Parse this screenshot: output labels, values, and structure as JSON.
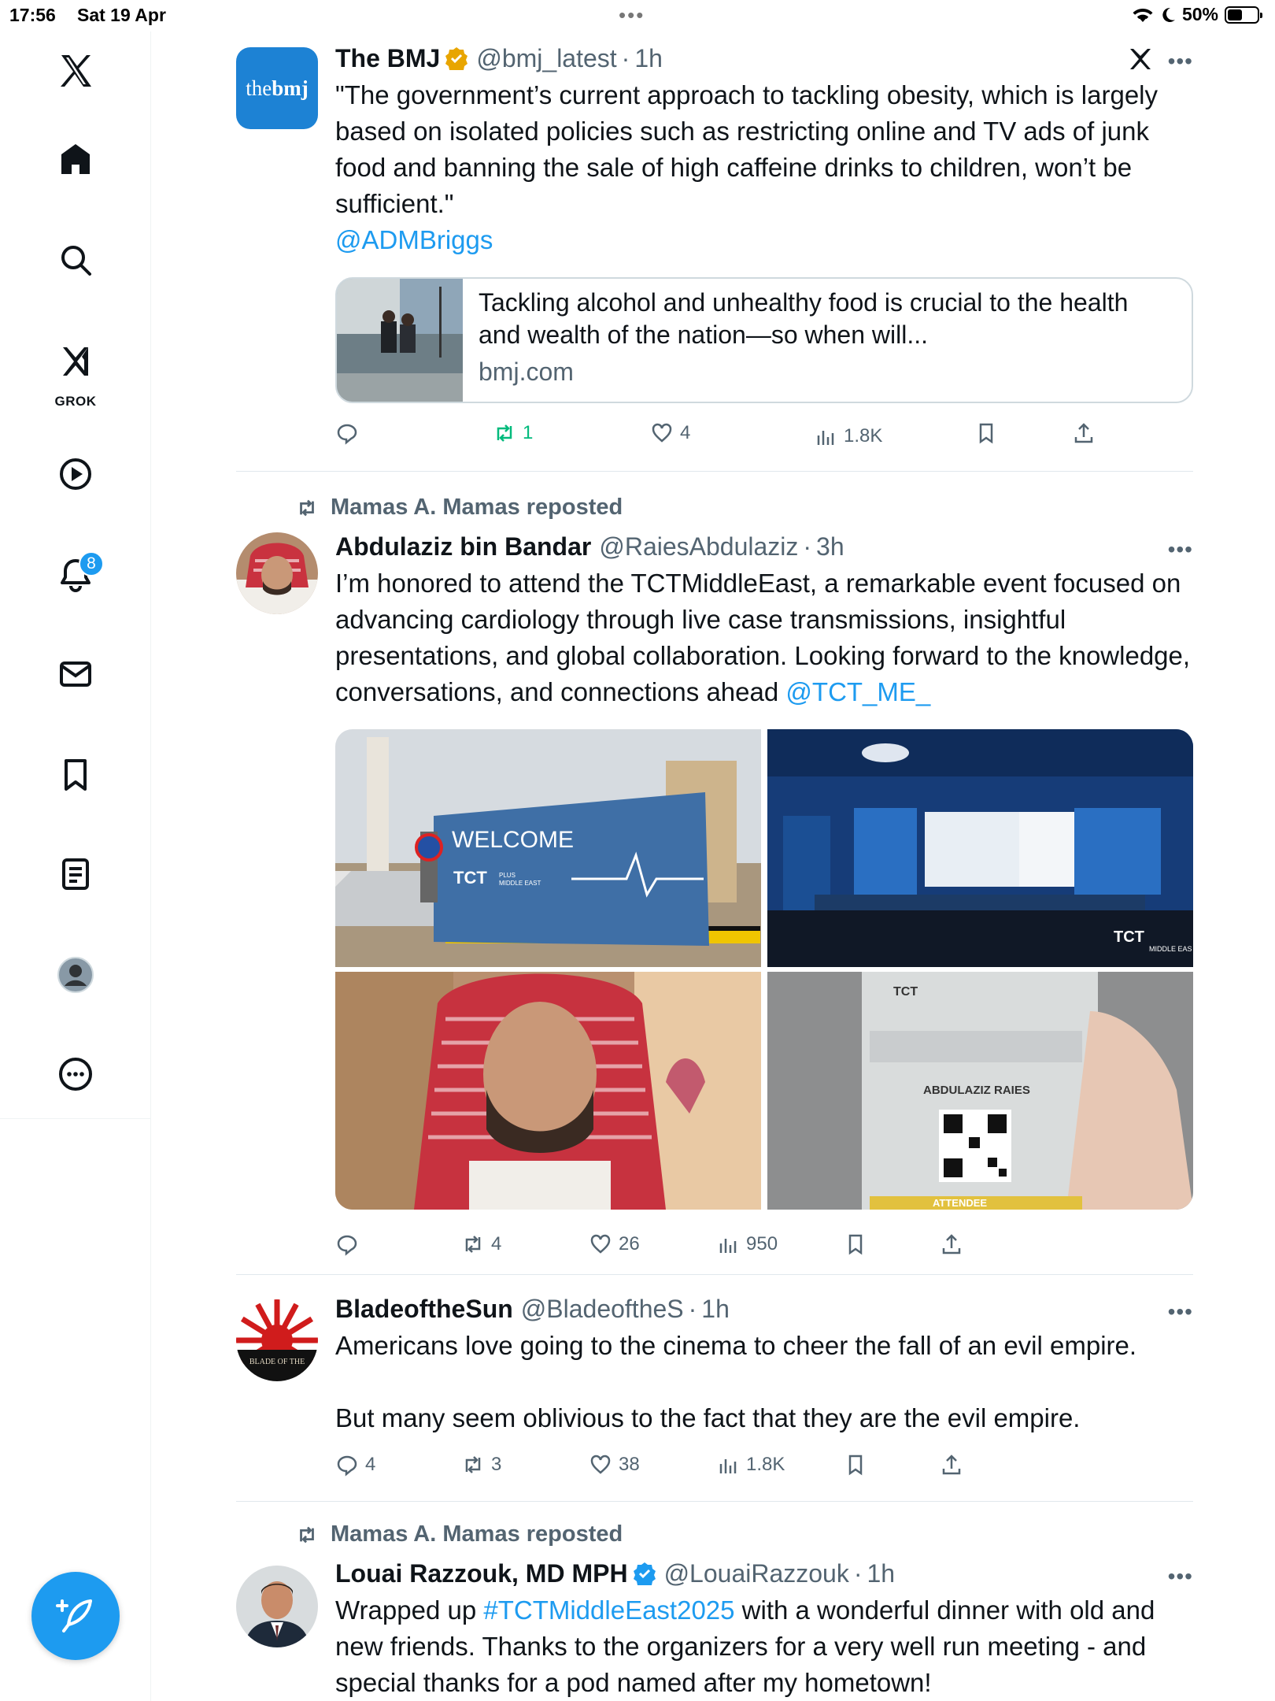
{
  "status_bar": {
    "time": "17:56",
    "date": "Sat 19 Apr",
    "battery": "50%",
    "battery_level": 0.5
  },
  "sidebar": {
    "items": [
      {
        "name": "x-logo"
      },
      {
        "name": "home"
      },
      {
        "name": "search"
      },
      {
        "name": "grok",
        "label": "GROK"
      },
      {
        "name": "video"
      },
      {
        "name": "notifications",
        "badge": "8"
      },
      {
        "name": "messages"
      },
      {
        "name": "bookmarks"
      },
      {
        "name": "lists"
      },
      {
        "name": "profile"
      },
      {
        "name": "more"
      }
    ]
  },
  "colors": {
    "accent": "#1d9bf0",
    "muted": "#536471",
    "repost_green": "#00ba7c",
    "gold": "#e8a500"
  },
  "tweets": [
    {
      "name": "The BMJ",
      "avatar_text_light": "the",
      "avatar_text_bold": "bmj",
      "verified": "gold",
      "handle": "@bmj_latest",
      "sep": "·",
      "time": "1h",
      "text": "\"The government’s current approach to tackling obesity, which is largely based on isolated policies such as restricting online and TV ads of junk food and banning the sale of high caffeine drinks to children, won’t be sufficient.\"",
      "mention": "@ADMBriggs",
      "card": {
        "title": "Tackling alcohol and unhealthy food is crucial to the health and wealth of the nation—so when will...",
        "domain": "bmj.com"
      },
      "actions": {
        "replies": "",
        "reposts": "1",
        "likes": "4",
        "views": "1.8K"
      }
    },
    {
      "reposted_by": "Mamas A. Mamas reposted",
      "name": "Abdulaziz bin Bandar",
      "handle": "@RaiesAbdulaziz",
      "sep": "·",
      "time": "3h",
      "text": "I’m honored to attend the TCTMiddleEast, a remarkable event focused on advancing cardiology through live case transmissions, insightful presentations, and global collaboration. Looking forward to the knowledge, conversations, and connections ahead ",
      "mention": "@TCT_ME_",
      "images": {
        "welcome": "WELCOME",
        "tct": "TCT",
        "plus": "PLUS",
        "middle_east": "MIDDLE EAST",
        "badge_name": "ABDULAZIZ RAIES",
        "badge_type": "ATTENDEE",
        "stage_tct": "TCT",
        "stage_sub": "MIDDLE EAS"
      },
      "actions": {
        "replies": "",
        "reposts": "4",
        "likes": "26",
        "views": "950"
      }
    },
    {
      "name": "BladeoftheSun",
      "avatar_text": "BLADE OF THE",
      "handle": "@BladeoftheS",
      "sep": "·",
      "time": "1h",
      "text": "Americans love going to the cinema to cheer the fall of an evil empire.\n\nBut many seem oblivious to the fact that they are the evil empire.",
      "actions": {
        "replies": "4",
        "reposts": "3",
        "likes": "38",
        "views": "1.8K"
      }
    },
    {
      "reposted_by": "Mamas A. Mamas reposted",
      "name": "Louai Razzouk, MD MPH",
      "verified": "blue",
      "handle": "@LouaiRazzouk",
      "sep": "·",
      "time": "1h",
      "text_before": "Wrapped up ",
      "hashtag": "#TCTMiddleEast2025",
      "text_after": " with a wonderful dinner with old and new friends. Thanks to the organizers for a very well run meeting - and special thanks for a pod named after my hometown!"
    }
  ]
}
